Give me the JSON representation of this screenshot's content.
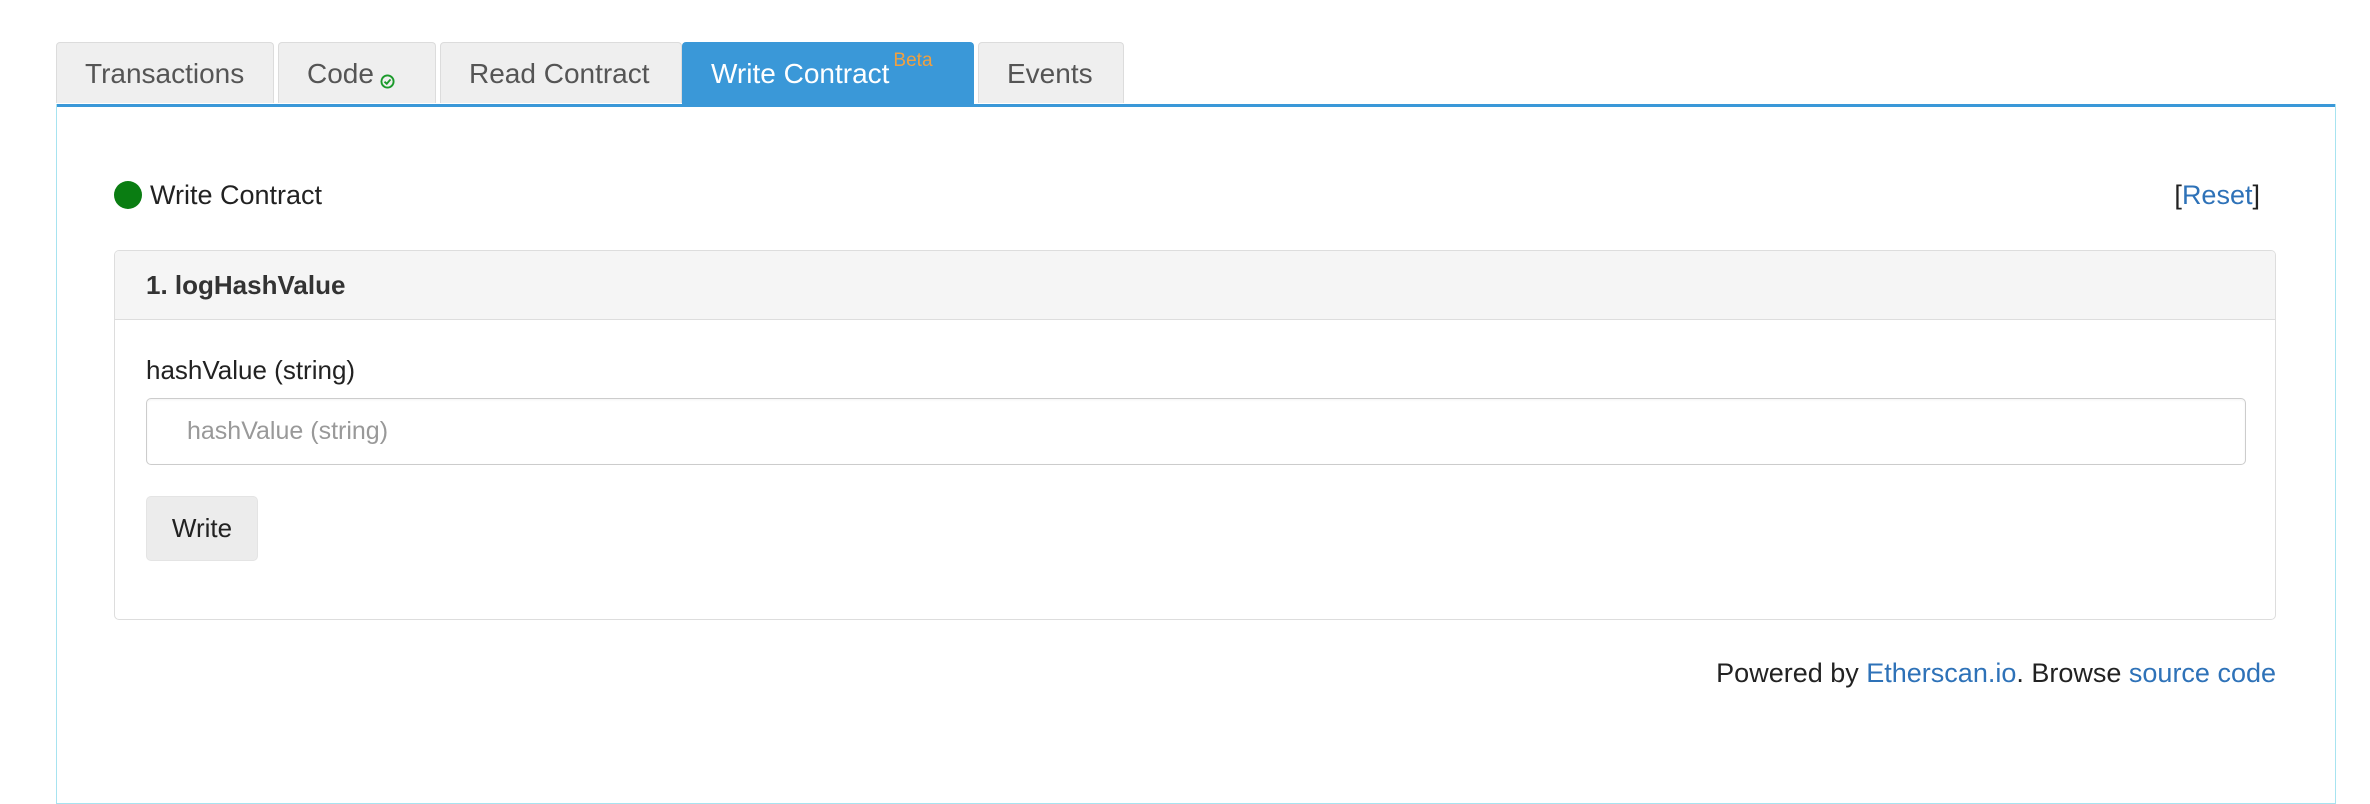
{
  "tabs": [
    {
      "label": "Transactions",
      "active": false
    },
    {
      "label": "Code",
      "active": false,
      "verified": true
    },
    {
      "label": "Read Contract",
      "active": false
    },
    {
      "label": "Write Contract",
      "active": true,
      "badge": "Beta"
    },
    {
      "label": "Events",
      "active": false
    }
  ],
  "header": {
    "title": "Write Contract",
    "status_color": "#0a7d12",
    "reset_open": "[",
    "reset_label": "Reset",
    "reset_close": "]"
  },
  "function": {
    "title": "1. logHashValue",
    "input_label": "hashValue (string)",
    "input_placeholder": "hashValue (string)",
    "input_value": "",
    "button_label": "Write"
  },
  "footer": {
    "prefix": "Powered by ",
    "link1": "Etherscan.io",
    "middle": ". Browse ",
    "link2": "source code"
  },
  "colors": {
    "accent": "#3a98d8",
    "link": "#2e72b8",
    "beta": "#f0a040"
  }
}
